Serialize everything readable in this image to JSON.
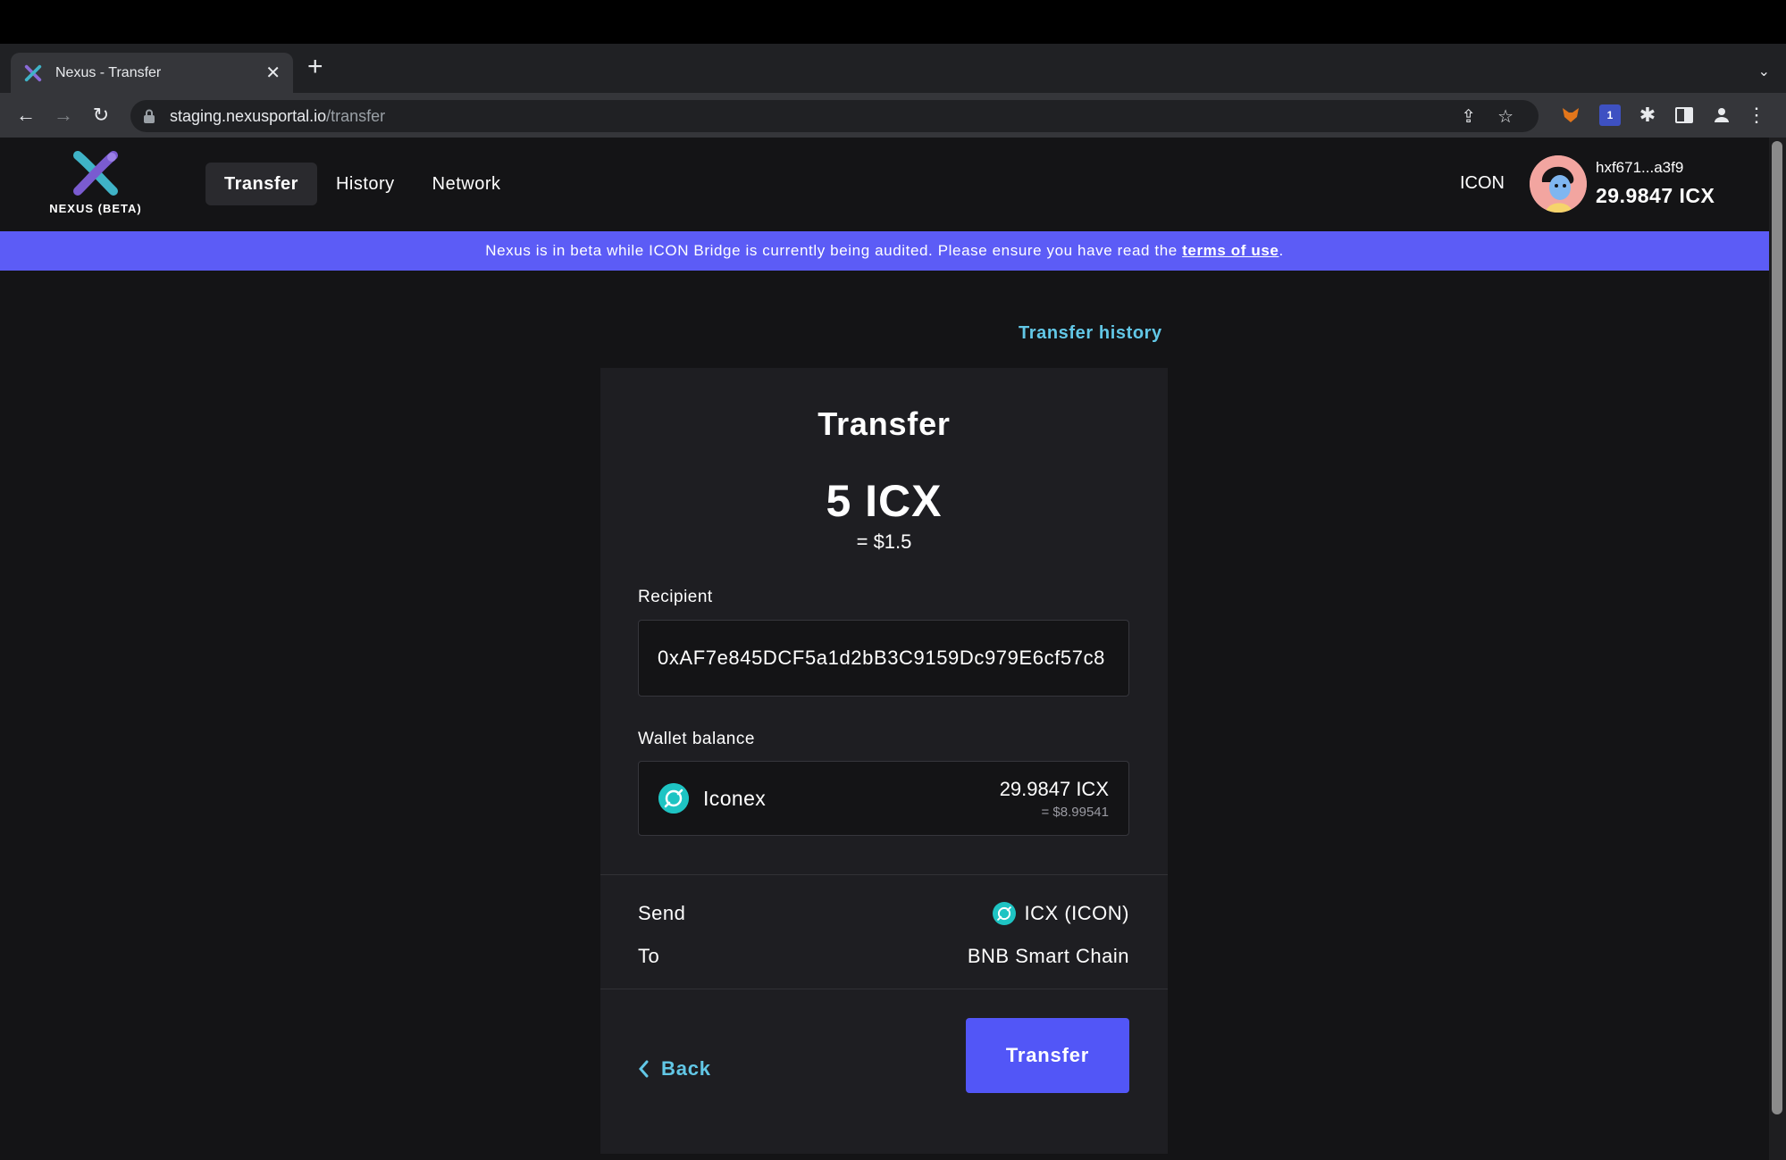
{
  "browser": {
    "tab_title": "Nexus - Transfer",
    "url_host": "staging.nexusportal.io",
    "url_path": "/transfer",
    "extension_badge": "1"
  },
  "header": {
    "logo_text": "NEXUS (BETA)",
    "nav": [
      {
        "label": "Transfer",
        "active": true
      },
      {
        "label": "History",
        "active": false
      },
      {
        "label": "Network",
        "active": false
      }
    ],
    "network": "ICON",
    "account_address": "hxf671...a3f9",
    "account_balance": "29.9847 ICX"
  },
  "banner": {
    "text": "Nexus is in beta while ICON Bridge is currently being audited. Please ensure you have read the",
    "link": "terms of use",
    "suffix": "."
  },
  "page": {
    "history_link": "Transfer history",
    "card_title": "Transfer",
    "amount": "5 ICX",
    "amount_usd": "= $1.5",
    "recipient_label": "Recipient",
    "recipient_value": "0xAF7e845DCF5a1d2bB3C9159Dc979E6cf57c8",
    "wallet_label": "Wallet balance",
    "wallet_name": "Iconex",
    "wallet_balance": "29.9847 ICX",
    "wallet_usd": "= $8.99541",
    "send_label": "Send",
    "send_value": "ICX (ICON)",
    "to_label": "To",
    "to_value": "BNB Smart Chain",
    "back_label": "Back",
    "transfer_button": "Transfer"
  },
  "colors": {
    "accent": "#5256f7",
    "banner": "#5c5cf6",
    "link": "#62c7e6",
    "icx": "#1ec4c3",
    "background": "#141416",
    "card": "#1e1e22"
  }
}
